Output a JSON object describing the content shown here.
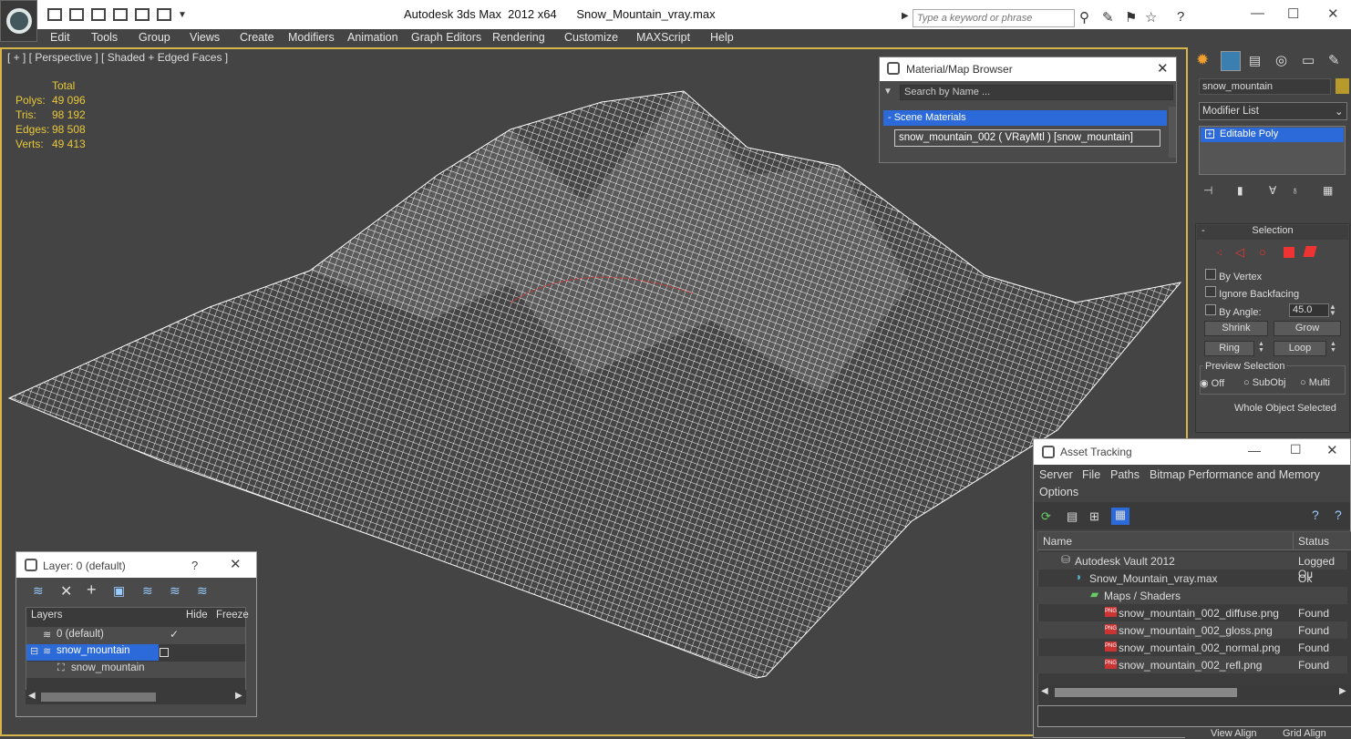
{
  "titlebar": {
    "app_title": "Autodesk 3ds Max  2012 x64",
    "file_title": "Snow_Mountain_vray.max",
    "search_placeholder": "Type a keyword or phrase"
  },
  "menu": [
    "Edit",
    "Tools",
    "Group",
    "Views",
    "Create",
    "Modifiers",
    "Animation",
    "Graph Editors",
    "Rendering",
    "Customize",
    "MAXScript",
    "Help"
  ],
  "viewport": {
    "label": "[ + ] [ Perspective ] [ Shaded + Edged Faces ]",
    "stats_header": "Total",
    "stats": [
      {
        "k": "Polys:",
        "v": "49 096"
      },
      {
        "k": "Tris:",
        "v": "98 192"
      },
      {
        "k": "Edges:",
        "v": "98 508"
      },
      {
        "k": "Verts:",
        "v": "49 413"
      }
    ]
  },
  "material_browser": {
    "title": "Material/Map Browser",
    "search_placeholder": "Search by Name ...",
    "section": "- Scene Materials",
    "item": "snow_mountain_002  ( VRayMtl ) [snow_mountain]"
  },
  "command_panel": {
    "object_name": "snow_mountain",
    "modifier_list": "Modifier List",
    "stack_item": "Editable Poly",
    "selection_title": "Selection",
    "by_vertex": "By Vertex",
    "ignore_backfacing": "Ignore Backfacing",
    "by_angle": "By Angle:",
    "angle_value": "45.0",
    "shrink": "Shrink",
    "grow": "Grow",
    "ring": "Ring",
    "loop": "Loop",
    "preview_selection": "Preview Selection",
    "off": "Off",
    "subobj": "SubObj",
    "multi": "Multi",
    "status": "Whole Object Selected"
  },
  "layer_dialog": {
    "title": "Layer: 0 (default)",
    "help": "?",
    "col_layers": "Layers",
    "col_hide": "Hide",
    "col_freeze": "Freeze",
    "rows": [
      {
        "name": "0 (default)"
      },
      {
        "name": "snow_mountain"
      },
      {
        "name": "snow_mountain"
      }
    ]
  },
  "asset_tracking": {
    "title": "Asset Tracking",
    "menu": [
      "Server",
      "File",
      "Paths",
      "Bitmap Performance and Memory",
      "Options"
    ],
    "col_name": "Name",
    "col_status": "Status",
    "rows": [
      {
        "name": "Autodesk Vault 2012",
        "status": "Logged Ou"
      },
      {
        "name": "Snow_Mountain_vray.max",
        "status": "Ok"
      },
      {
        "name": "Maps / Shaders",
        "status": ""
      },
      {
        "name": "snow_mountain_002_diffuse.png",
        "status": "Found"
      },
      {
        "name": "snow_mountain_002_gloss.png",
        "status": "Found"
      },
      {
        "name": "snow_mountain_002_normal.png",
        "status": "Found"
      },
      {
        "name": "snow_mountain_002_refl.png",
        "status": "Found"
      }
    ]
  },
  "bottom": {
    "view_align": "View Align",
    "grid_align": "Grid Align"
  },
  "colors": {
    "accent_yellow": "#d6b54a",
    "selection_blue": "#2b6ad8",
    "wire": "#ffffff",
    "viewport_bg": "#444444"
  }
}
